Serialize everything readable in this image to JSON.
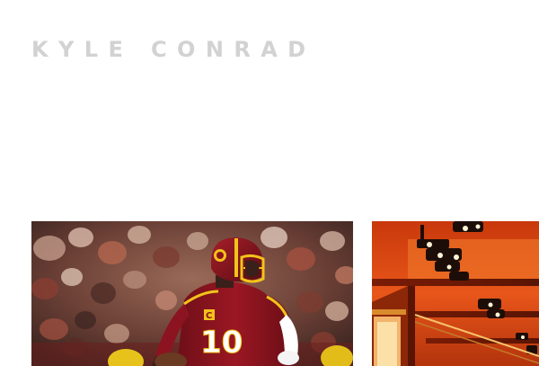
{
  "header": {
    "site_title": "KYLE CONRAD"
  },
  "gallery": {
    "items": [
      {
        "icon": "football-player-photo"
      },
      {
        "icon": "ceiling-lights-photo"
      }
    ]
  },
  "colors": {
    "title": "#d2d2d2",
    "background": "#ffffff",
    "jersey": "#8c1420",
    "helmet_gold": "#f2c319",
    "ceiling": "#d9420c"
  }
}
